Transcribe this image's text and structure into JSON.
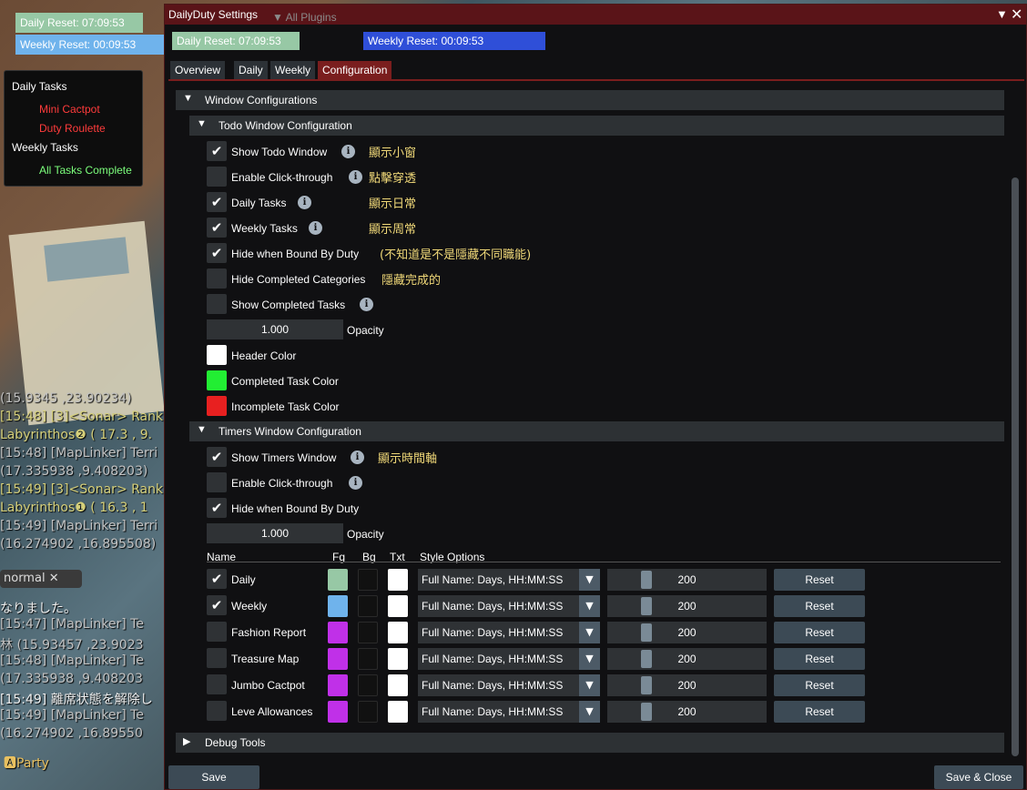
{
  "background": {
    "chat": [
      {
        "text": "(15.9345 ,23.90234)",
        "style": "g"
      },
      {
        "text": "[15:48] [3]<Sonar> Rank",
        "style": "y"
      },
      {
        "text": "  Labyrinthos❷ ( 17.3 , 9.",
        "style": "y"
      },
      {
        "text": "[15:48] [MapLinker] Terri",
        "style": "g"
      },
      {
        "text": "  (17.335938 ,9.408203)",
        "style": "g"
      },
      {
        "text": "[15:49] [3]<Sonar> Rank",
        "style": "y"
      },
      {
        "text": "  Labyrinthos❶ ( 16.3 , 1",
        "style": "y"
      },
      {
        "text": "[15:49] [MapLinker] Terri",
        "style": "g"
      },
      {
        "text": "  (16.274902 ,16.895508)",
        "style": "g"
      }
    ],
    "chat2": [
      {
        "text": "なりました。",
        "style": "w"
      },
      {
        "text": "[15:47] [MapLinker] Te",
        "style": "g"
      },
      {
        "text": "  林 (15.93457 ,23.9023",
        "style": "g"
      },
      {
        "text": "[15:48] [MapLinker] Te",
        "style": "g"
      },
      {
        "text": "  (17.335938 ,9.408203",
        "style": "g"
      },
      {
        "text": "[15:49] 離席状態を解除し",
        "style": "w"
      },
      {
        "text": "[15:49] [MapLinker] Te",
        "style": "g"
      },
      {
        "text": "  (16.274902 ,16.89550",
        "style": "g"
      }
    ],
    "chat_tab": "normal",
    "party": "Party"
  },
  "overlay": {
    "daily_reset": "Daily Reset: 07:09:53",
    "weekly_reset": "Weekly Reset: 00:09:53",
    "todo": {
      "daily_header": "Daily Tasks",
      "daily_items": [
        "Mini Cactpot",
        "Duty Roulette"
      ],
      "weekly_header": "Weekly Tasks",
      "weekly_items": [
        "All Tasks Complete"
      ]
    }
  },
  "window": {
    "title": "DailyDuty Settings",
    "ghost_title": "All Plugins",
    "daily_reset": "Daily Reset: 07:09:53",
    "weekly_reset": "Weekly Reset: 00:09:53",
    "tabs": [
      "Overview",
      "Daily",
      "Weekly",
      "Configuration"
    ],
    "active_tab": "Configuration",
    "section_window": "Window Configurations",
    "section_todo": "Todo Window Configuration",
    "todo_options": [
      {
        "label": "Show Todo Window",
        "checked": true,
        "note": "顯示小窗"
      },
      {
        "label": "Enable Click-through",
        "checked": false,
        "note": "點擊穿透"
      },
      {
        "label": "Daily Tasks",
        "checked": true,
        "note": "顯示日常"
      },
      {
        "label": "Weekly Tasks",
        "checked": true,
        "note": "顯示周常"
      },
      {
        "label": "Hide when Bound By Duty",
        "checked": true,
        "note": "(不知道是不是隱藏不同職能)"
      },
      {
        "label": "Hide Completed Categories",
        "checked": false,
        "note": "隱藏完成的"
      },
      {
        "label": "Show Completed Tasks",
        "checked": false,
        "note": ""
      }
    ],
    "todo_opacity": "1.000",
    "opacity_label": "Opacity",
    "colors": [
      {
        "label": "Header Color",
        "color": "#ffffff"
      },
      {
        "label": "Completed Task Color",
        "color": "#22ee33"
      },
      {
        "label": "Incomplete Task Color",
        "color": "#e82020"
      }
    ],
    "section_timers": "Timers Window Configuration",
    "timer_options": [
      {
        "label": "Show Timers Window",
        "checked": true,
        "note": "顯示時間軸"
      },
      {
        "label": "Enable Click-through",
        "checked": false,
        "note": ""
      },
      {
        "label": "Hide when Bound By Duty",
        "checked": true,
        "note": ""
      }
    ],
    "timers_opacity": "1.000",
    "table_headers": [
      "Name",
      "Fg",
      "Bg",
      "Txt",
      "Style Options"
    ],
    "timers": [
      {
        "name": "Daily",
        "checked": true,
        "fg": "#97c8a5",
        "style": "Full Name: Days, HH:MM:SS",
        "value": "200",
        "reset": "Reset"
      },
      {
        "name": "Weekly",
        "checked": true,
        "fg": "#6fb3ec",
        "style": "Full Name: Days, HH:MM:SS",
        "value": "200",
        "reset": "Reset"
      },
      {
        "name": "Fashion Report",
        "checked": false,
        "fg": "#c030e8",
        "style": "Full Name: Days, HH:MM:SS",
        "value": "200",
        "reset": "Reset"
      },
      {
        "name": "Treasure Map",
        "checked": false,
        "fg": "#c030e8",
        "style": "Full Name: Days, HH:MM:SS",
        "value": "200",
        "reset": "Reset"
      },
      {
        "name": "Jumbo Cactpot",
        "checked": false,
        "fg": "#c030e8",
        "style": "Full Name: Days, HH:MM:SS",
        "value": "200",
        "reset": "Reset"
      },
      {
        "name": "Leve Allowances",
        "checked": false,
        "fg": "#c030e8",
        "style": "Full Name: Days, HH:MM:SS",
        "value": "200",
        "reset": "Reset"
      }
    ],
    "section_debug": "Debug Tools",
    "save": "Save",
    "save_close": "Save & Close"
  }
}
